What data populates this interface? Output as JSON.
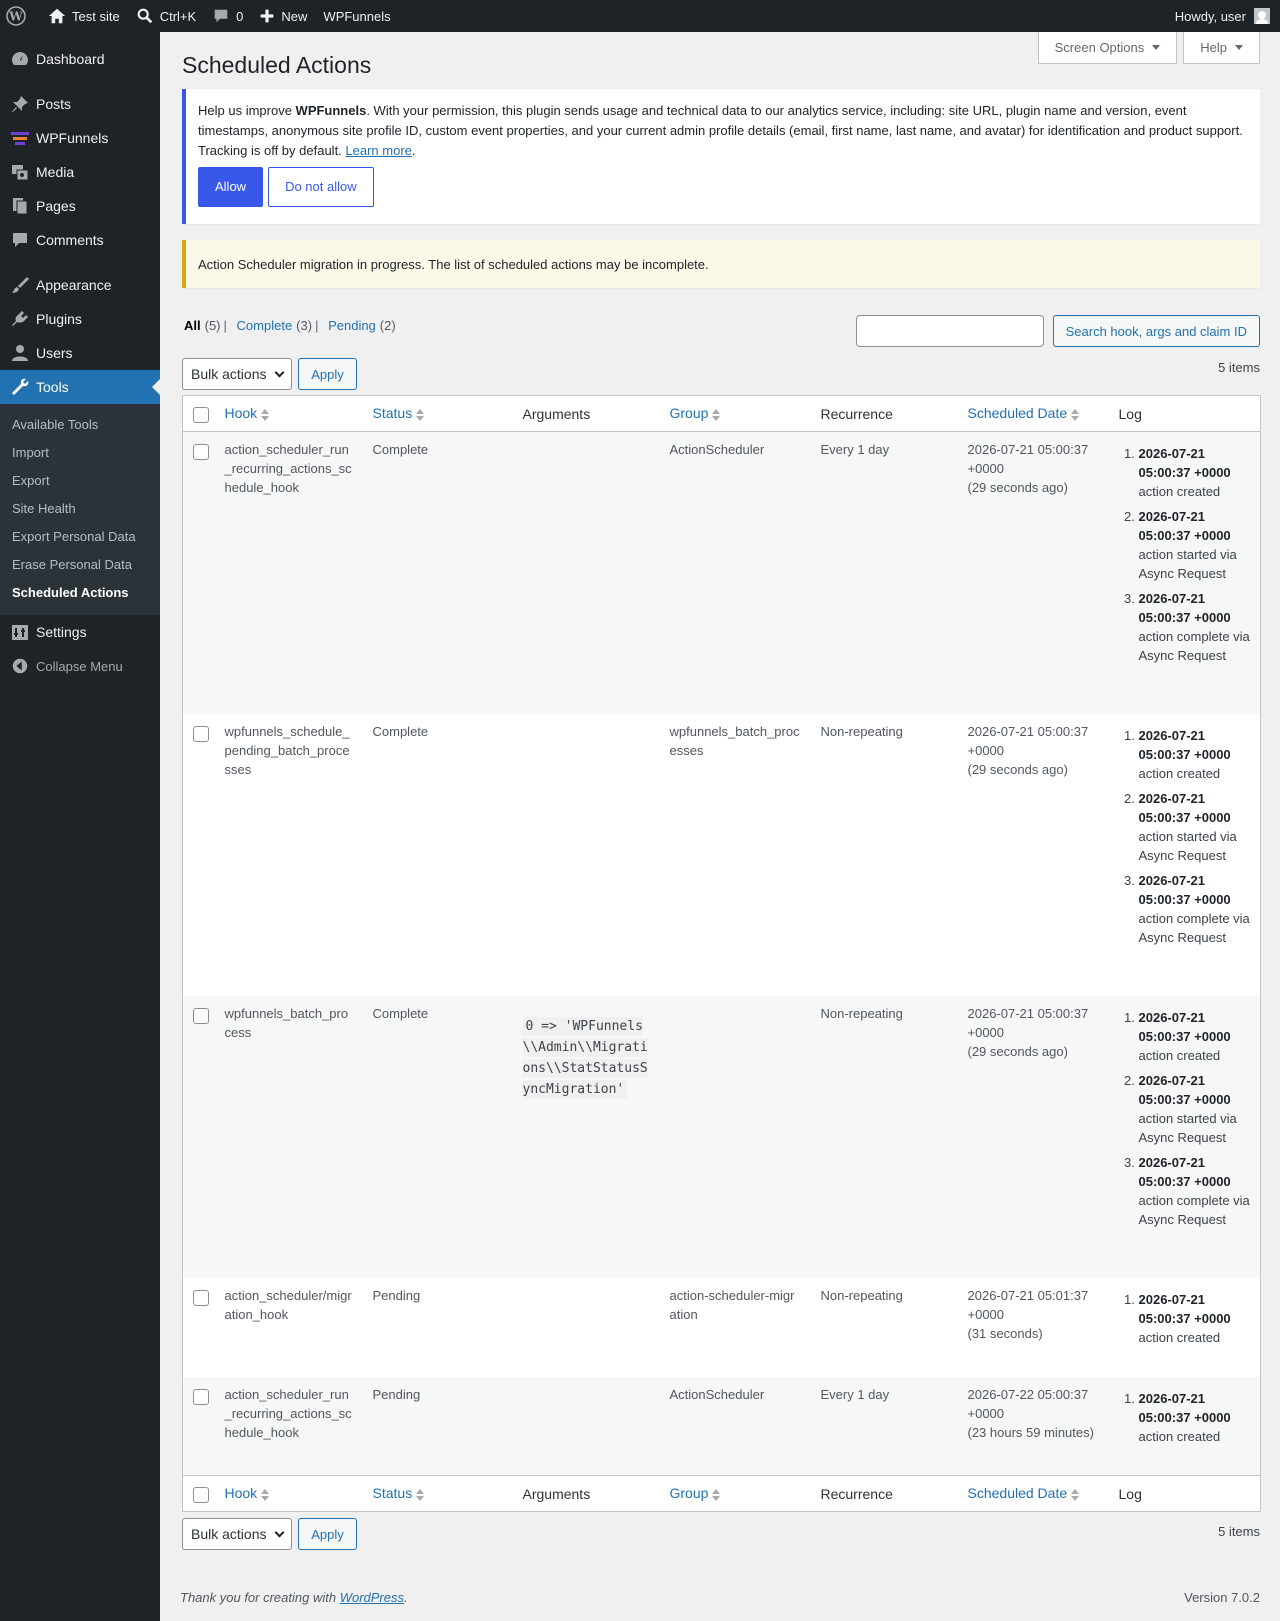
{
  "adminbar": {
    "site": "Test site",
    "search": "Ctrl+K",
    "comments_count": "0",
    "new": "New",
    "plugin": "WPFunnels",
    "howdy": "Howdy, user"
  },
  "sidebar": {
    "items": [
      {
        "label": "Dashboard",
        "icon": "dashboard-icon"
      },
      {
        "label": "Posts",
        "icon": "pin-icon"
      },
      {
        "label": "WPFunnels",
        "icon": "wpfunnels-icon"
      },
      {
        "label": "Media",
        "icon": "media-icon"
      },
      {
        "label": "Pages",
        "icon": "pages-icon"
      },
      {
        "label": "Comments",
        "icon": "comment-icon"
      },
      {
        "label": "Appearance",
        "icon": "brush-icon"
      },
      {
        "label": "Plugins",
        "icon": "plug-icon"
      },
      {
        "label": "Users",
        "icon": "user-icon"
      },
      {
        "label": "Tools",
        "icon": "wrench-icon"
      },
      {
        "label": "Settings",
        "icon": "settings-icon"
      }
    ],
    "tools_submenu": [
      "Available Tools",
      "Import",
      "Export",
      "Site Health",
      "Export Personal Data",
      "Erase Personal Data",
      "Scheduled Actions"
    ],
    "collapse": "Collapse Menu"
  },
  "screen_options": "Screen Options",
  "help": "Help",
  "page_title": "Scheduled Actions",
  "tracking_notice": {
    "text_before": "Help us improve ",
    "brand": "WPFunnels",
    "text_after": ". With your permission, this plugin sends usage and technical data to our analytics service, including: site URL, plugin name and version, event timestamps, anonymous site profile ID, custom event properties, and your current admin profile details (email, first name, last name, and avatar) for identification and product support. Tracking is off by default. ",
    "learn_more": "Learn more",
    "period": ".",
    "allow": "Allow",
    "deny": "Do not allow"
  },
  "migration_notice": "Action Scheduler migration in progress. The list of scheduled actions may be incomplete.",
  "filters": {
    "all": "All",
    "all_count": "(5)",
    "complete": "Complete",
    "complete_count": "(3)",
    "pending": "Pending",
    "pending_count": "(2)",
    "sep": "|"
  },
  "search_button": "Search hook, args and claim ID",
  "bulk_actions": "Bulk actions",
  "apply": "Apply",
  "items_count": "5 items",
  "columns": {
    "hook": "Hook",
    "status": "Status",
    "arguments": "Arguments",
    "group": "Group",
    "recurrence": "Recurrence",
    "scheduled_date": "Scheduled Date",
    "log": "Log"
  },
  "rows": [
    {
      "hook": "action_scheduler_run_recurring_actions_schedule_hook",
      "status": "Complete",
      "args": "",
      "group": "ActionScheduler",
      "recurrence": "Every 1 day",
      "date": "2026-07-21 05:00:37 +0000",
      "relative": "(29 seconds ago)",
      "log": [
        {
          "time": "2026-07-21 05:00:37 +0000",
          "msg": "action created"
        },
        {
          "time": "2026-07-21 05:00:37 +0000",
          "msg": "action started via Async Request"
        },
        {
          "time": "2026-07-21 05:00:37 +0000",
          "msg": "action complete via Async Request"
        }
      ]
    },
    {
      "hook": "wpfunnels_schedule_pending_batch_processes",
      "status": "Complete",
      "args": "",
      "group": "wpfunnels_batch_processes",
      "recurrence": "Non-repeating",
      "date": "2026-07-21 05:00:37 +0000",
      "relative": "(29 seconds ago)",
      "log": [
        {
          "time": "2026-07-21 05:00:37 +0000",
          "msg": "action created"
        },
        {
          "time": "2026-07-21 05:00:37 +0000",
          "msg": "action started via Async Request"
        },
        {
          "time": "2026-07-21 05:00:37 +0000",
          "msg": "action complete via Async Request"
        }
      ]
    },
    {
      "hook": "wpfunnels_batch_process",
      "status": "Complete",
      "args": "0 => 'WPFunnels\\\\Admin\\\\Migrations\\\\StatStatusSyncMigration'",
      "group": "",
      "recurrence": "Non-repeating",
      "date": "2026-07-21 05:00:37 +0000",
      "relative": "(29 seconds ago)",
      "log": [
        {
          "time": "2026-07-21 05:00:37 +0000",
          "msg": "action created"
        },
        {
          "time": "2026-07-21 05:00:37 +0000",
          "msg": "action started via Async Request"
        },
        {
          "time": "2026-07-21 05:00:37 +0000",
          "msg": "action complete via Async Request"
        }
      ]
    },
    {
      "hook": "action_scheduler/migration_hook",
      "status": "Pending",
      "args": "",
      "group": "action-scheduler-migration",
      "recurrence": "Non-repeating",
      "date": "2026-07-21 05:01:37 +0000",
      "relative": "(31 seconds)",
      "log": [
        {
          "time": "2026-07-21 05:00:37 +0000",
          "msg": "action created"
        }
      ]
    },
    {
      "hook": "action_scheduler_run_recurring_actions_schedule_hook",
      "status": "Pending",
      "args": "",
      "group": "ActionScheduler",
      "recurrence": "Every 1 day",
      "date": "2026-07-22 05:00:37 +0000",
      "relative": "(23 hours 59 minutes)",
      "log": [
        {
          "time": "2026-07-21 05:00:37 +0000",
          "msg": "action created"
        }
      ]
    }
  ],
  "footer": {
    "thanks_before": "Thank you for creating with ",
    "wordpress": "WordPress",
    "thanks_after": ".",
    "version": "Version 7.0.2"
  }
}
